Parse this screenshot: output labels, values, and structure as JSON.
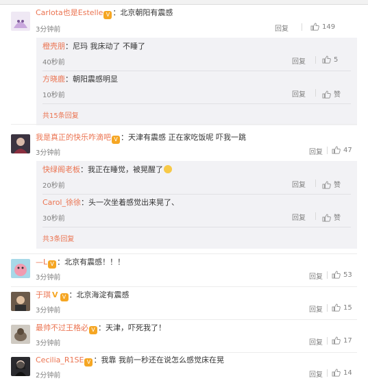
{
  "comments": [
    {
      "name": "Carlota也是Estelle",
      "text": "：北京朝阳有震感",
      "time": "3分钟前",
      "reply": "回复",
      "likes": "149",
      "replies": [
        {
          "name": "橙壳朋",
          "text": "：尼玛 我床动了  不睡了",
          "time": "40秒前",
          "reply": "回复",
          "likes": "5"
        },
        {
          "name": "方晓鹿",
          "text": "：朝阳震感明显",
          "time": "10秒前",
          "reply": "回复",
          "likes": "赞"
        }
      ],
      "more": "共15条回复"
    },
    {
      "name": "我是真正的快乐咋滴吧",
      "text": "：天津有震感 正在家吃饭呢 吓我一跳",
      "time": "3分钟前",
      "reply": "回复",
      "likes": "47",
      "replies": [
        {
          "name": "快绿阁老板",
          "text": "：我正在睡觉，被晃醒了",
          "time": "20秒前",
          "reply": "回复",
          "likes": "赞"
        },
        {
          "name": "Carol_徐徐",
          "text": "：头一次坐着感觉出来晃了、",
          "time": "30秒前",
          "reply": "回复",
          "likes": "赞"
        }
      ],
      "more": "共3条回复"
    },
    {
      "name": "—L",
      "text": "：北京有震感！！！",
      "time": "3分钟前",
      "reply": "回复",
      "likes": "53"
    },
    {
      "name": "于琪",
      "text": "：北京海淀有震感",
      "time": "3分钟前",
      "reply": "回复",
      "likes": "15"
    },
    {
      "name": "最帅不过王格必",
      "text": "：天津，吓死我了！",
      "time": "3分钟前",
      "reply": "回复",
      "likes": "17"
    },
    {
      "name": "Cecilia_R1SE",
      "text": "：我靠 我前一秒还在说怎么感觉床在晃",
      "time": "2分钟前",
      "reply": "回复",
      "likes": "14"
    }
  ],
  "colors": {
    "name": "#eb7350",
    "muted": "#808080",
    "reply_box": "#f2f2f5",
    "badge": "#f5a623"
  },
  "icons": {
    "like": "thumbs-up-icon",
    "badge": "verified-badge-icon",
    "vip": "vip-crown-icon",
    "emoji": "sleepy-face-emoji-icon"
  }
}
